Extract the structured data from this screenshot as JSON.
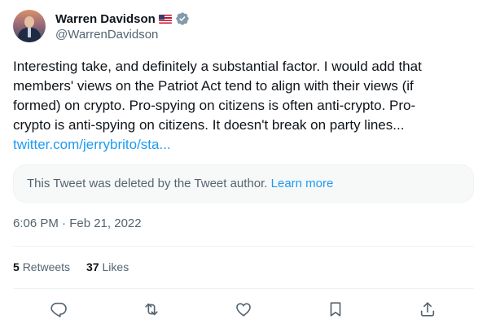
{
  "author": {
    "display_name": "Warren Davidson",
    "handle": "@WarrenDavidson"
  },
  "tweet": {
    "lines": [
      "Interesting take, and definitely a substantial factor. I would add that",
      "members' views on the Patriot Act tend to align with their views (if",
      "formed) on crypto. Pro-spying on citizens is often anti-crypto. Pro-",
      "crypto is anti-spying on citizens. It doesn't break on party lines..."
    ],
    "link": "twitter.com/jerrybrito/sta..."
  },
  "quote": {
    "text": "This Tweet was deleted by the Tweet author.",
    "learn_more": "Learn more"
  },
  "timestamp": "6:06 PM · Feb 21, 2022",
  "stats": {
    "retweets_count": "5",
    "retweets_label": "Retweets",
    "likes_count": "37",
    "likes_label": "Likes"
  },
  "icons": {
    "reply": "reply-icon",
    "retweet": "retweet-icon",
    "like": "heart-icon",
    "bookmark": "bookmark-icon",
    "share": "share-icon"
  },
  "colors": {
    "link": "#1d9bf0",
    "secondary_text": "#536471",
    "verified_badge": "#829aab"
  }
}
